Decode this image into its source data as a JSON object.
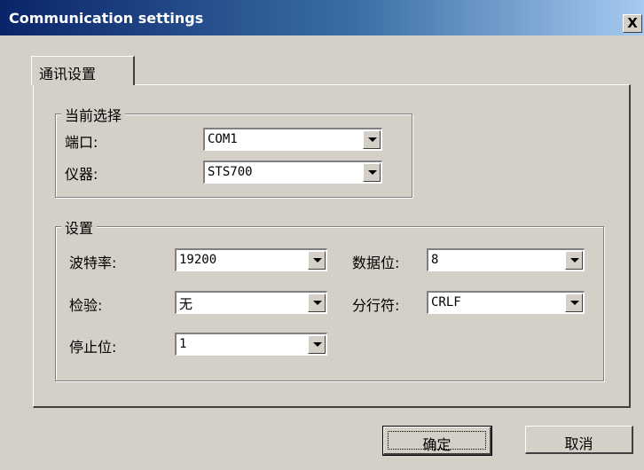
{
  "window": {
    "title": "Communication settings",
    "close_label": "X"
  },
  "tabs": [
    {
      "label": "通讯设置",
      "selected": true
    }
  ],
  "current_selection": {
    "legend": "当前选择",
    "port": {
      "label": "端口:",
      "value": "COM1"
    },
    "instrument": {
      "label": "仪器:",
      "value": "STS700"
    }
  },
  "settings": {
    "legend": "设置",
    "baud_rate": {
      "label": "波特率:",
      "value": "19200"
    },
    "parity": {
      "label": "检验:",
      "value": "无"
    },
    "stop_bits": {
      "label": "停止位:",
      "value": "1"
    },
    "data_bits": {
      "label": "数据位:",
      "value": "8"
    },
    "line_separator": {
      "label": "分行符:",
      "value": "CRLF"
    }
  },
  "buttons": {
    "ok_label": "确定",
    "cancel_label": "取消"
  },
  "colors": {
    "face": "#d4d0c8",
    "title_start": "#0a246a",
    "title_end": "#a6caf0"
  }
}
